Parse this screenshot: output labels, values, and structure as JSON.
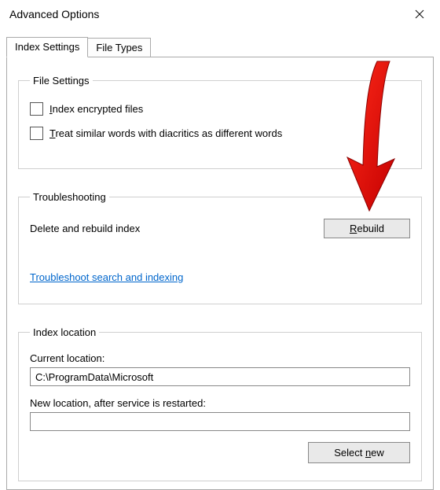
{
  "window": {
    "title": "Advanced Options"
  },
  "tabs": {
    "index_settings": "Index Settings",
    "file_types": "File Types"
  },
  "file_settings": {
    "legend": "File Settings",
    "index_encrypted": "Index encrypted files",
    "treat_diacritics": "Treat similar words with diacritics as different words"
  },
  "troubleshooting": {
    "legend": "Troubleshooting",
    "delete_rebuild": "Delete and rebuild index",
    "rebuild_btn": "Rebuild",
    "troubleshoot_link": "Troubleshoot search and indexing"
  },
  "index_location": {
    "legend": "Index location",
    "current_label": "Current location:",
    "current_value": "C:\\ProgramData\\Microsoft",
    "new_label": "New location, after service is restarted:",
    "new_value": "",
    "select_new_btn": "Select new"
  }
}
